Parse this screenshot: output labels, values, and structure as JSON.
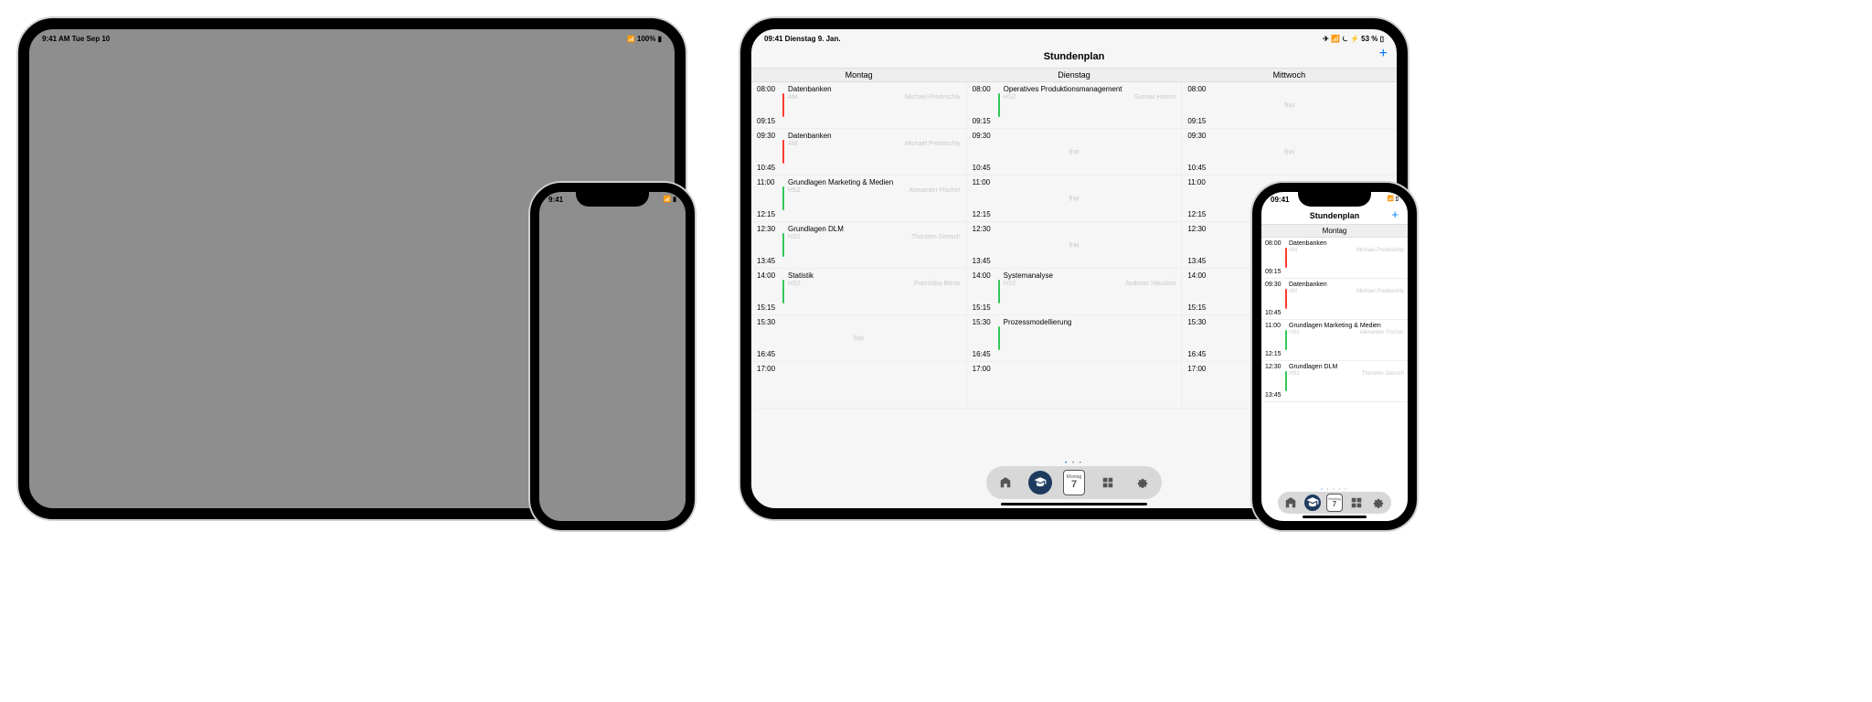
{
  "left_ipad": {
    "status_left": "9:41 AM   Tue Sep 10",
    "status_right": "100%"
  },
  "left_iphone": {
    "status_left": "9:41"
  },
  "right_ipad": {
    "status_left": "09:41   Dienstag 9. Jan.",
    "status_right": "53 %"
  },
  "right_iphone": {
    "status_left": "09:41"
  },
  "app": {
    "title": "Stundenplan",
    "days": [
      "Montag",
      "Dienstag",
      "Mittwoch"
    ],
    "free_label": "frei",
    "tab_cal_day": "Montag",
    "tab_cal_num": "7",
    "blocks": [
      {
        "start": "08:00",
        "end": "09:15",
        "cols": [
          {
            "c": "red",
            "title": "Datenbanken",
            "room": "AM",
            "teacher": "Michael Predeschly"
          },
          {
            "c": "grn",
            "title": "Operatives Produktionsmanagement",
            "room": "HS2",
            "teacher": "Gunnar Harms"
          },
          {
            "free": true
          }
        ]
      },
      {
        "start": "09:30",
        "end": "10:45",
        "cols": [
          {
            "c": "red",
            "title": "Datenbanken",
            "room": "AM",
            "teacher": "Michael Predeschly"
          },
          {
            "free": true
          },
          {
            "free": true
          }
        ]
      },
      {
        "start": "11:00",
        "end": "12:15",
        "cols": [
          {
            "c": "grn",
            "title": "Grundlagen Marketing & Medien",
            "room": "HS2",
            "teacher": "Alexander Fischer"
          },
          {
            "free": true
          },
          {
            "free": true
          }
        ]
      },
      {
        "start": "12:30",
        "end": "13:45",
        "cols": [
          {
            "c": "grn",
            "title": "Grundlagen DLM",
            "room": "HS2",
            "teacher": "Thorsten Giersch"
          },
          {
            "free": true
          },
          {
            "free": true
          }
        ]
      },
      {
        "start": "14:00",
        "end": "15:15",
        "cols": [
          {
            "c": "grn",
            "title": "Statistik",
            "room": "HS2",
            "teacher": "Franziska Bönte"
          },
          {
            "c": "grn",
            "title": "Systemanalyse",
            "room": "HS2",
            "teacher": "Andreas Häuslein"
          },
          {
            "free": true
          }
        ]
      },
      {
        "start": "15:30",
        "end": "16:45",
        "cols": [
          {
            "free": true
          },
          {
            "c": "grn",
            "title": "Prozessmodellierung",
            "room": "",
            "teacher": ""
          },
          {
            "free": true
          }
        ]
      },
      {
        "start": "17:00",
        "end": "",
        "cols": [
          {
            "free": false
          },
          {
            "free": false
          },
          {
            "free": false
          }
        ]
      }
    ],
    "phone_blocks": [
      {
        "start": "08:00",
        "end": "09:15",
        "c": "red",
        "title": "Datenbanken",
        "room": "AM",
        "teacher": "Michael Predeschly"
      },
      {
        "start": "09:30",
        "end": "10:45",
        "c": "red",
        "title": "Datenbanken",
        "room": "AM",
        "teacher": "Michael Predeschly"
      },
      {
        "start": "11:00",
        "end": "12:15",
        "c": "grn",
        "title": "Grundlagen Marketing & Medien",
        "room": "HS2",
        "teacher": "Alexander Fischer"
      },
      {
        "start": "12:30",
        "end": "13:45",
        "c": "grn",
        "title": "Grundlagen DLM",
        "room": "HS2",
        "teacher": "Thorsten Giersch"
      }
    ]
  }
}
